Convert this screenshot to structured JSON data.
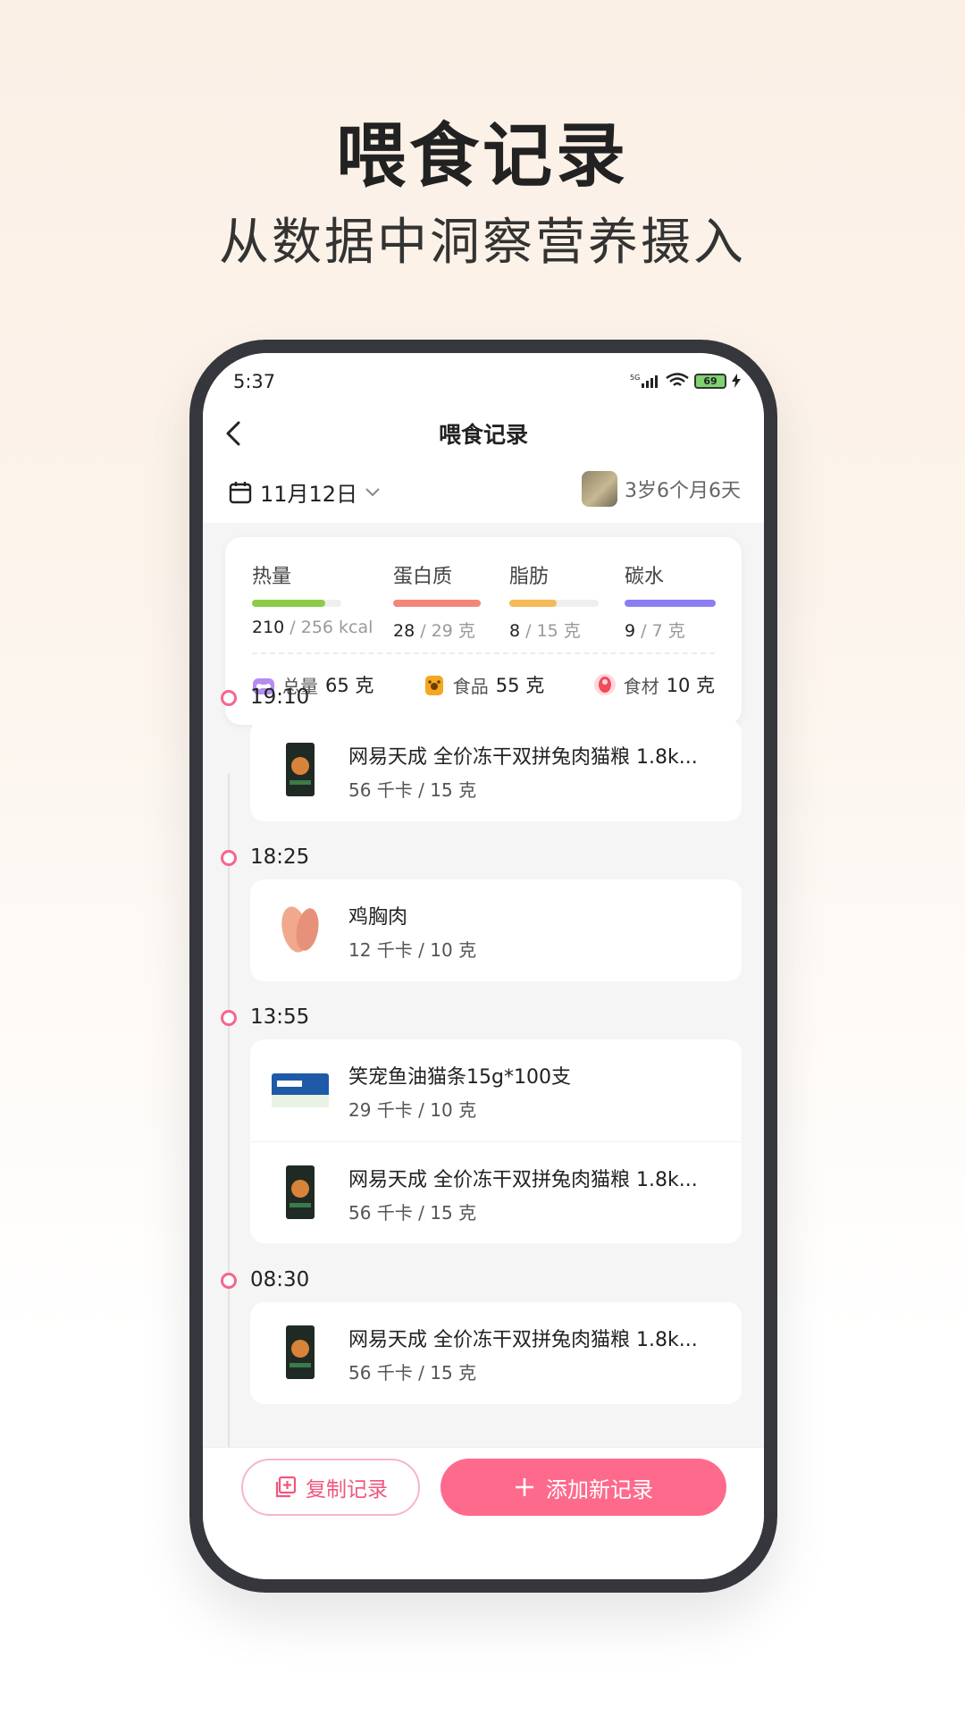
{
  "hero": {
    "title": "喂食记录",
    "subtitle": "从数据中洞察营养摄入"
  },
  "status_bar": {
    "time": "5:37",
    "network": "5G",
    "battery": "69"
  },
  "nav": {
    "title": "喂食记录",
    "back_icon": "chevron-left-icon"
  },
  "date_selector": {
    "date": "11月12日",
    "icon": "calendar-icon"
  },
  "pet": {
    "age": "3岁6个月6天"
  },
  "colors": {
    "accent": "#fe6a8c",
    "calorie": "#8dcc46",
    "protein": "#f28779",
    "fat": "#f5b956",
    "carb": "#8c7ef2"
  },
  "summary": {
    "nutrients": [
      {
        "label": "热量",
        "value": "210",
        "target": " / 256 kcal",
        "progress": 0.82
      },
      {
        "label": "蛋白质",
        "value": "28",
        "target": " / 29 克",
        "progress": 1.0
      },
      {
        "label": "脂肪",
        "value": "8",
        "target": " / 15 克",
        "progress": 0.53
      },
      {
        "label": "碳水",
        "value": "9",
        "target": " / 7 克",
        "progress": 1.0
      }
    ],
    "totals": [
      {
        "label": "总量",
        "value": "65 克",
        "icon": "bowl-icon"
      },
      {
        "label": "食品",
        "value": "55 克",
        "icon": "food-bag-icon"
      },
      {
        "label": "食材",
        "value": "10 克",
        "icon": "meat-icon"
      }
    ]
  },
  "timeline": [
    {
      "time": "19:10",
      "items": [
        {
          "name": "网易天成 全价冻干双拼兔肉猫粮 1.8k...",
          "detail": "56 千卡 / 15 克"
        }
      ]
    },
    {
      "time": "18:25",
      "items": [
        {
          "name": "鸡胸肉",
          "detail": "12 千卡 / 10 克"
        }
      ]
    },
    {
      "time": "13:55",
      "items": [
        {
          "name": "笑宠鱼油猫条15g*100支",
          "detail": "29 千卡 / 10 克"
        },
        {
          "name": "网易天成 全价冻干双拼兔肉猫粮 1.8k...",
          "detail": "56 千卡 / 15 克"
        }
      ]
    },
    {
      "time": "08:30",
      "items": [
        {
          "name": "网易天成 全价冻干双拼兔肉猫粮 1.8k...",
          "detail": "56 千卡 / 15 克"
        }
      ]
    }
  ],
  "actions": {
    "copy_label": "复制记录",
    "add_label": "添加新记录"
  }
}
